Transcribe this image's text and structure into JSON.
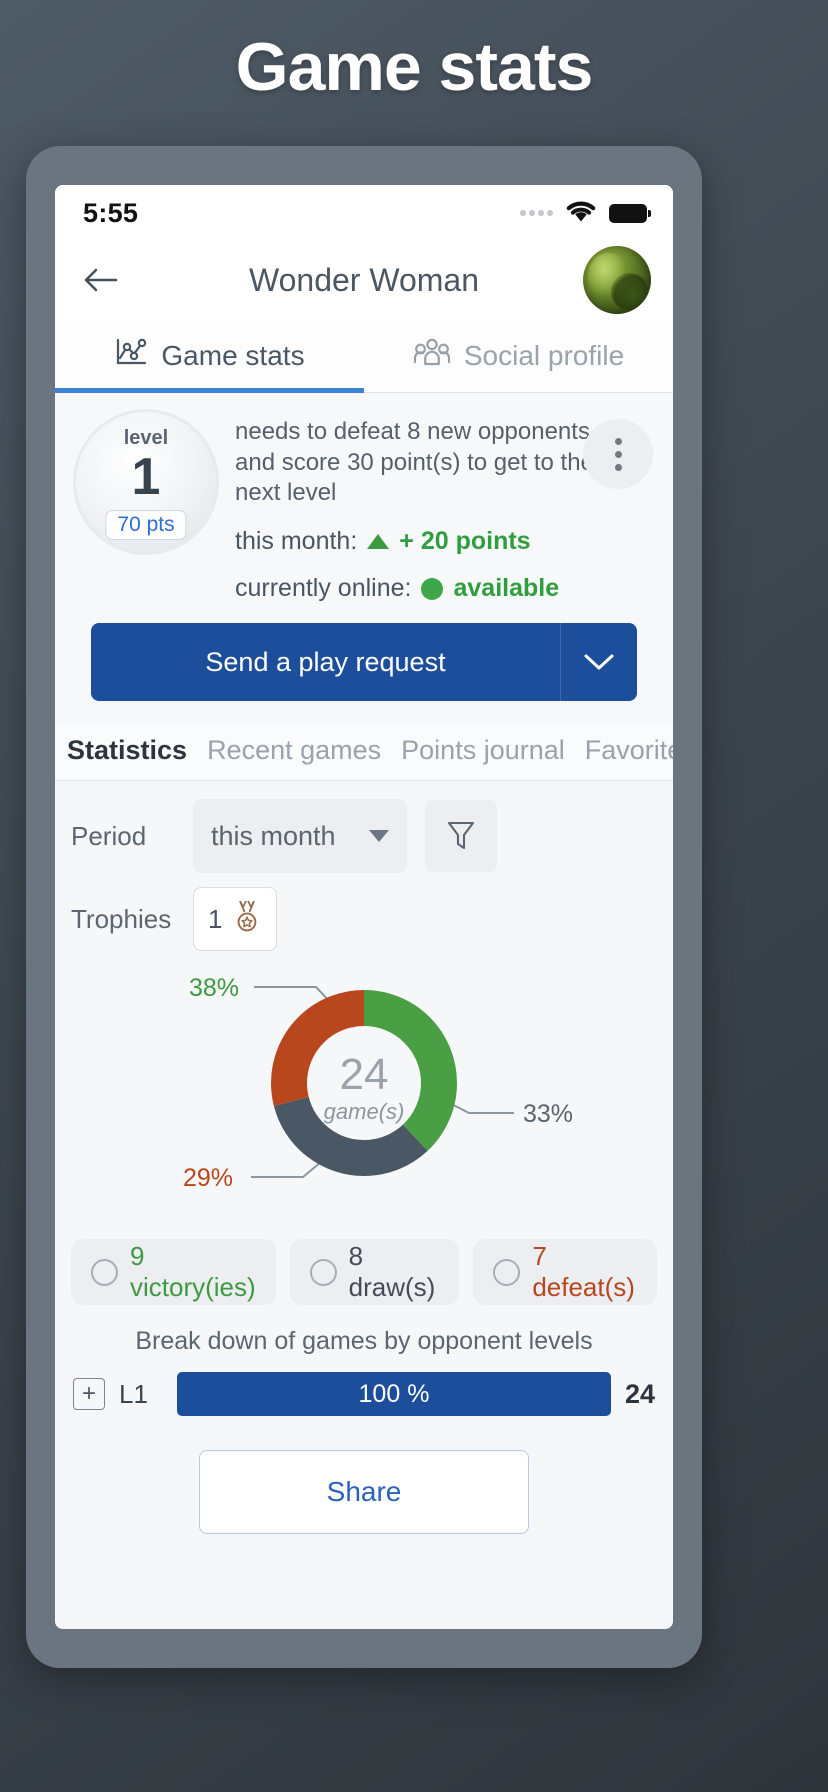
{
  "page": {
    "title": "Game stats"
  },
  "status_bar": {
    "time": "5:55",
    "signal_icon": "signal-dots-icon",
    "wifi_icon": "wifi-icon",
    "battery_icon": "battery-icon"
  },
  "header": {
    "back_icon": "back-arrow-icon",
    "title": "Wonder Woman",
    "avatar_label": "avatar"
  },
  "main_tabs": [
    {
      "label": "Game stats",
      "icon": "chart-scatter-icon",
      "active": true
    },
    {
      "label": "Social profile",
      "icon": "people-group-icon",
      "active": false
    }
  ],
  "summary": {
    "level_word": "level",
    "level_number": "1",
    "points_badge": "70 pts",
    "description": "needs to defeat 8 new opponents and score 30 point(s) to get to the next level",
    "month_label": "this month:",
    "month_value": "+ 20 points",
    "online_label": "currently online:",
    "online_value": "available",
    "menu_icon": "kebab-menu-icon"
  },
  "cta": {
    "label": "Send a play request",
    "caret_icon": "chevron-down-icon"
  },
  "sub_tabs": [
    {
      "label": "Statistics",
      "active": true
    },
    {
      "label": "Recent games",
      "active": false
    },
    {
      "label": "Points journal",
      "active": false
    },
    {
      "label": "Favorite ga",
      "active": false
    }
  ],
  "filters": {
    "period_label": "Period",
    "period_value": "this month",
    "filter_icon": "funnel-filter-icon",
    "trophies_label": "Trophies",
    "trophies_count": "1",
    "trophy_icon": "medal-icon"
  },
  "chart_data": {
    "type": "pie",
    "title": "",
    "center_value": "24",
    "center_label": "game(s)",
    "categories": [
      "victories",
      "draws",
      "defeats"
    ],
    "values": [
      9,
      8,
      7
    ],
    "percent_labels": [
      "38%",
      "33%",
      "29%"
    ],
    "colors": [
      "#4a9f45",
      "#4a5764",
      "#b8471d"
    ],
    "legend_position": "bottom"
  },
  "legend": [
    {
      "label": "9 victory(ies)",
      "kind": "win"
    },
    {
      "label": "8 draw(s)",
      "kind": "draw"
    },
    {
      "label": "7 defeat(s)",
      "kind": "lose"
    }
  ],
  "breakdown": {
    "title": "Break down of games by opponent levels",
    "expand_icon": "plus-box-icon",
    "rows": [
      {
        "level": "L1",
        "percent": "100 %",
        "count": "24",
        "fill_ratio": 1
      }
    ]
  },
  "share": {
    "label": "Share"
  }
}
